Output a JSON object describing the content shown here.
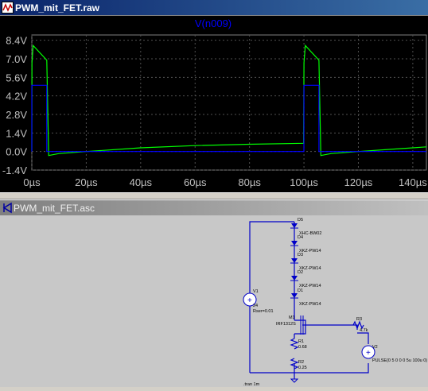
{
  "waveform_window": {
    "title": "PWM_mit_FET.raw",
    "trace_label": "V(n009)",
    "icon": "waveform-icon"
  },
  "schematic_window": {
    "title": "PWM_mit_FET.asc",
    "icon": "schematic-icon",
    "labels": {
      "D5": "D5",
      "D5_model": "XHC-BW02",
      "D4": "D4",
      "D4_model": "XKZ-PW14",
      "D3": "D3",
      "D3_model": "XKZ-PW14",
      "D2": "D2",
      "D2_model": "XKZ-PW14",
      "D1": "D1",
      "D1_model": "XKZ-PW14",
      "V1": "V1",
      "V1_value": "24",
      "V1_rser": "Rser=0.01",
      "M1": "M1",
      "M1_model": "IRF1312S",
      "R1": "R1",
      "R1_value": "0.68",
      "R2": "R2",
      "R2_value": "0.25",
      "R3": "R3",
      "R3_value": "4.7k",
      "V2": "V2",
      "V2_value": "PULSE(0 5 0 0 0 5u 100u 0)",
      "tran": ".tran 1m"
    }
  },
  "chart_data": {
    "type": "line",
    "title": "V(n009)",
    "xlabel": "",
    "ylabel": "",
    "xlim": [
      0,
      145
    ],
    "ylim": [
      -1.4,
      8.8
    ],
    "x_ticks": [
      "0µs",
      "20µs",
      "40µs",
      "60µs",
      "80µs",
      "100µs",
      "120µs",
      "140µs"
    ],
    "x_tick_values": [
      0,
      20,
      40,
      60,
      80,
      100,
      120,
      140
    ],
    "y_ticks": [
      "8.4V",
      "7.0V",
      "5.6V",
      "4.2V",
      "2.8V",
      "1.4V",
      "0.0V",
      "-1.4V"
    ],
    "y_tick_values": [
      8.4,
      7.0,
      5.6,
      4.2,
      2.8,
      1.4,
      0.0,
      -1.4
    ],
    "grid": true,
    "series": [
      {
        "color": "#00ff00",
        "x": [
          0,
          0.05,
          0.5,
          5.5,
          6.2,
          10,
          20,
          40,
          60,
          80,
          99.9,
          100,
          100.5,
          105.5,
          106.2,
          110,
          120,
          145
        ],
        "values": [
          0.05,
          6.7,
          8.0,
          6.9,
          -0.3,
          -0.15,
          0.0,
          0.28,
          0.45,
          0.55,
          0.62,
          6.7,
          8.0,
          6.9,
          -0.3,
          -0.15,
          0.0,
          0.35
        ]
      },
      {
        "color": "#0000ff",
        "x": [
          0,
          0.01,
          5.5,
          5.51,
          99.99,
          100,
          105.5,
          105.51,
          145
        ],
        "values": [
          0,
          5.0,
          5.0,
          0,
          0,
          5.0,
          5.0,
          0,
          0
        ]
      }
    ]
  }
}
